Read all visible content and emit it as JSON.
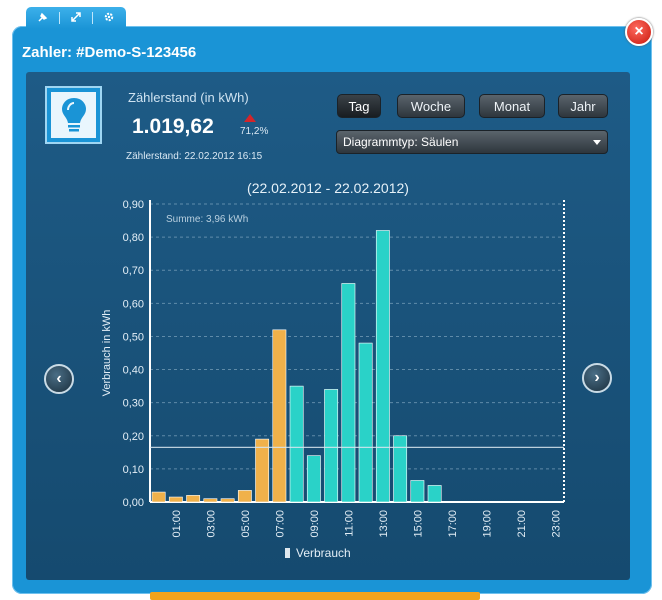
{
  "window": {
    "title": "Zahler: #Demo-S-123456",
    "close_label": "×"
  },
  "toolbar": {
    "icons": [
      "pin-icon",
      "resize-icon",
      "settings-icon"
    ]
  },
  "meter": {
    "label": "Zählerstand (in kWh)",
    "value": "1.019,62",
    "trend": "71,2%",
    "trend_color": "#d3252a",
    "date": "Zählerstand: 22.02.2012 16:15"
  },
  "period_buttons": [
    {
      "label": "Tag",
      "active": true
    },
    {
      "label": "Woche",
      "active": false
    },
    {
      "label": "Monat",
      "active": false
    },
    {
      "label": "Jahr",
      "active": false
    }
  ],
  "chart_type_select": {
    "value": "Diagrammtyp:  Säulen"
  },
  "date_range": "(22.02.2012 - 22.02.2012)",
  "nav": {
    "prev": "‹",
    "next": "›"
  },
  "chart_data": {
    "type": "bar",
    "sum_label": "Summe: 3,96 kWh",
    "ylabel": "Verbrauch in kWh",
    "ylim": [
      0,
      0.9
    ],
    "yticks": [
      "0,00",
      "0,10",
      "0,20",
      "0,30",
      "0,40",
      "0,50",
      "0,60",
      "0,70",
      "0,80",
      "0,90"
    ],
    "xtick_labels": [
      "01:00",
      "03:00",
      "05:00",
      "07:00",
      "09:00",
      "11:00",
      "13:00",
      "15:00",
      "17:00",
      "19:00",
      "21:00",
      "23:00"
    ],
    "average_line": 0.165,
    "categories": [
      "00",
      "01",
      "02",
      "03",
      "04",
      "05",
      "06",
      "07",
      "08",
      "09",
      "10",
      "11",
      "12",
      "13",
      "14",
      "15",
      "16",
      "17",
      "18",
      "19",
      "20",
      "21",
      "22",
      "23"
    ],
    "series": [
      {
        "name": "Verbrauch",
        "values": [
          0.03,
          0.015,
          0.02,
          0.01,
          0.01,
          0.035,
          0.19,
          0.52,
          0.35,
          0.14,
          0.34,
          0.66,
          0.48,
          0.82,
          0.2,
          0.065,
          0.05,
          0,
          0,
          0,
          0,
          0,
          0,
          0
        ],
        "colors": [
          "#f0b14a",
          "#f0b14a",
          "#f0b14a",
          "#f0b14a",
          "#f0b14a",
          "#f0b14a",
          "#f0b14a",
          "#f0b14a",
          "#2ad2c8",
          "#2ad2c8",
          "#2ad2c8",
          "#2ad2c8",
          "#2ad2c8",
          "#2ad2c8",
          "#2ad2c8",
          "#2ad2c8",
          "#2ad2c8",
          "#2ad2c8",
          "#2ad2c8",
          "#2ad2c8",
          "#2ad2c8",
          "#2ad2c8",
          "#2ad2c8",
          "#2ad2c8"
        ]
      }
    ],
    "legend": "Verbrauch",
    "legend_position": "bottom"
  }
}
